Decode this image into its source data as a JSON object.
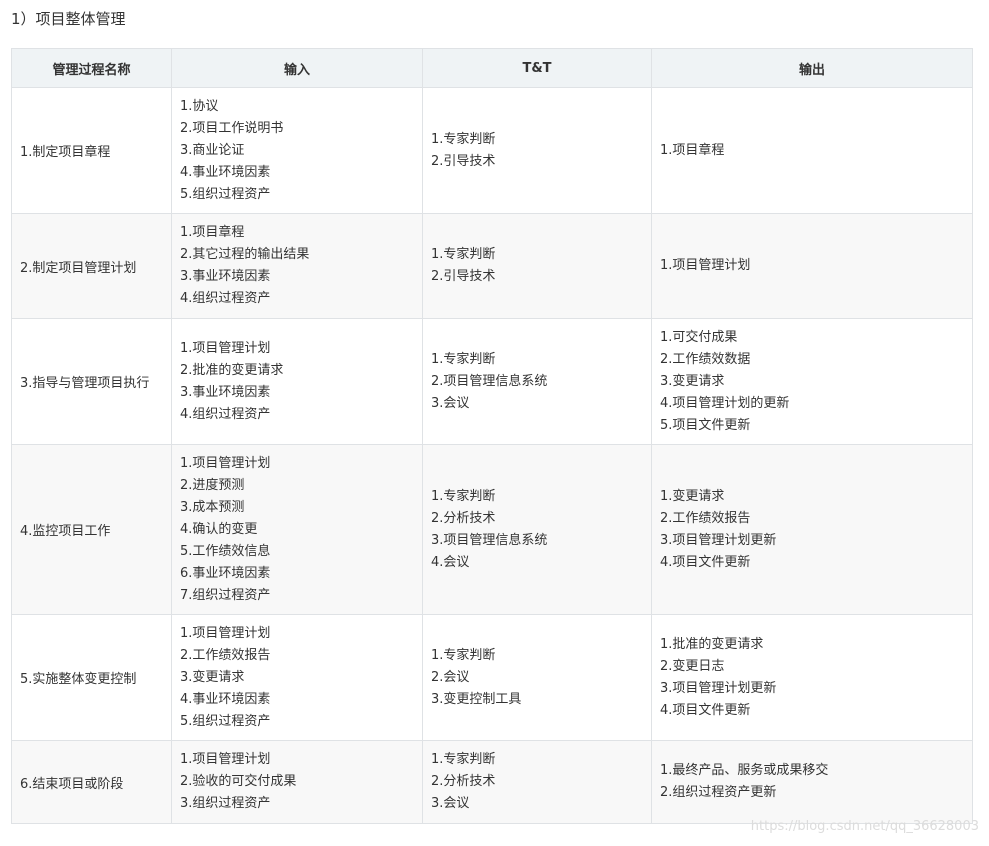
{
  "section_title": "1）项目整体管理",
  "table": {
    "headers": [
      "管理过程名称",
      "输入",
      "T&T",
      "输出"
    ],
    "rows": [
      {
        "name": "1.制定项目章程",
        "inputs": [
          "1.协议",
          "2.项目工作说明书",
          "3.商业论证",
          "4.事业环境因素",
          "5.组织过程资产"
        ],
        "tools": [
          "1.专家判断",
          "2.引导技术"
        ],
        "outputs": [
          "1.项目章程"
        ]
      },
      {
        "name": "2.制定项目管理计划",
        "inputs": [
          "1.项目章程",
          "2.其它过程的输出结果",
          "3.事业环境因素",
          "4.组织过程资产"
        ],
        "tools": [
          "1.专家判断",
          "2.引导技术"
        ],
        "outputs": [
          "1.项目管理计划"
        ]
      },
      {
        "name": "3.指导与管理项目执行",
        "inputs": [
          "1.项目管理计划",
          "2.批准的变更请求",
          "3.事业环境因素",
          "4.组织过程资产"
        ],
        "tools": [
          "1.专家判断",
          "2.项目管理信息系统",
          "3.会议"
        ],
        "outputs": [
          "1.可交付成果",
          "2.工作绩效数据",
          "3.变更请求",
          "4.项目管理计划的更新",
          "5.项目文件更新"
        ]
      },
      {
        "name": "4.监控项目工作",
        "inputs": [
          "1.项目管理计划",
          "2.进度预测",
          "3.成本预测",
          "4.确认的变更",
          "5.工作绩效信息",
          "6.事业环境因素",
          "7.组织过程资产"
        ],
        "tools": [
          "1.专家判断",
          "2.分析技术",
          "3.项目管理信息系统",
          "4.会议"
        ],
        "outputs": [
          "1.变更请求",
          "2.工作绩效报告",
          "3.项目管理计划更新",
          "4.项目文件更新"
        ]
      },
      {
        "name": "5.实施整体变更控制",
        "inputs": [
          "1.项目管理计划",
          "2.工作绩效报告",
          "3.变更请求",
          "4.事业环境因素",
          "5.组织过程资产"
        ],
        "tools": [
          "1.专家判断",
          "2.会议",
          "3.变更控制工具"
        ],
        "outputs": [
          "1.批准的变更请求",
          "2.变更日志",
          "3.项目管理计划更新",
          "4.项目文件更新"
        ]
      },
      {
        "name": "6.结束项目或阶段",
        "inputs": [
          "1.项目管理计划",
          "2.验收的可交付成果",
          "3.组织过程资产"
        ],
        "tools": [
          "1.专家判断",
          "2.分析技术",
          "3.会议"
        ],
        "outputs": [
          "1.最终产品、服务或成果移交",
          "2.组织过程资产更新"
        ]
      }
    ]
  },
  "watermark": "https://blog.csdn.net/qq_36628003"
}
